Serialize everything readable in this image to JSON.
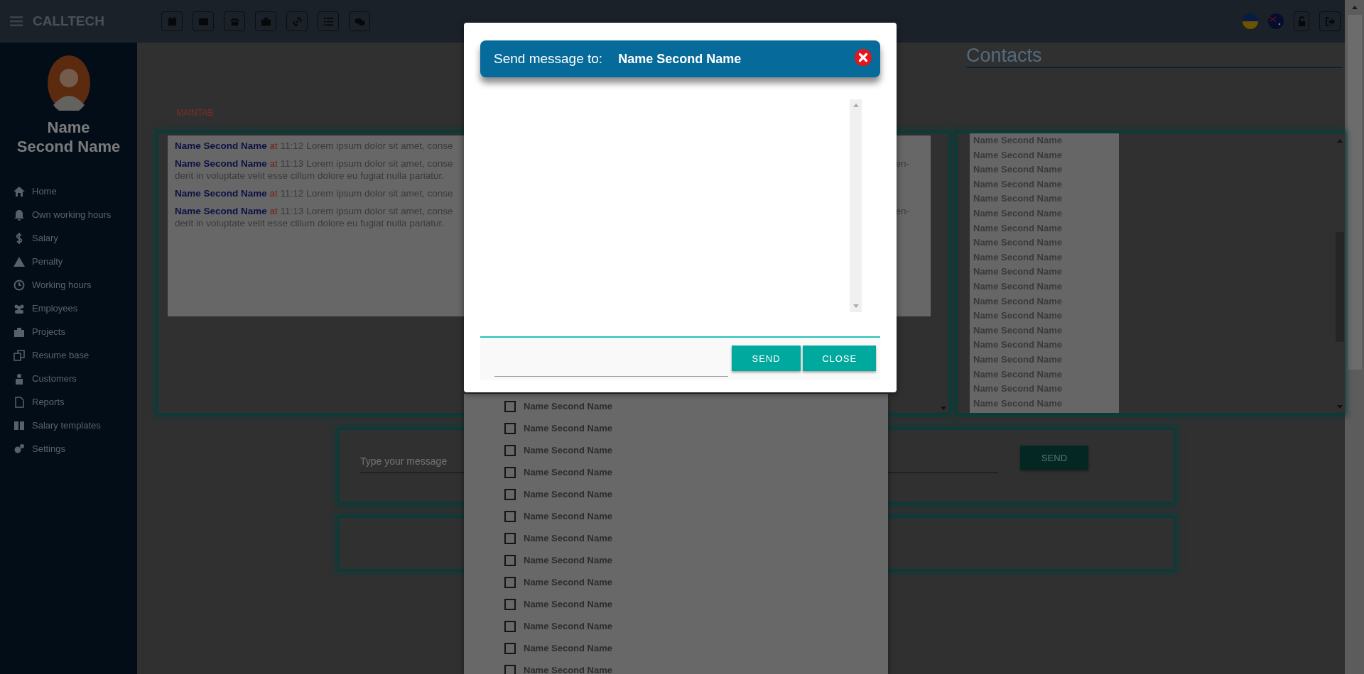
{
  "app": {
    "logo": "CALLTECH"
  },
  "user": {
    "first_name": "Name",
    "last_name": "Second Name"
  },
  "menu": [
    {
      "label": "Home"
    },
    {
      "label": "Own working hours"
    },
    {
      "label": "Salary"
    },
    {
      "label": "Penalty"
    },
    {
      "label": "Working hours"
    },
    {
      "label": "Employees"
    },
    {
      "label": "Projects"
    },
    {
      "label": "Resume base"
    },
    {
      "label": "Customers"
    },
    {
      "label": "Reports"
    },
    {
      "label": "Salary templates"
    },
    {
      "label": "Settings"
    }
  ],
  "tab_label": "MAINTAB",
  "messages": [
    {
      "author": "Name Second Name",
      "at": "at",
      "time": "11:12",
      "text": "Lorem ipsum dolor sit amet, conse"
    },
    {
      "author": "Name Second Name",
      "at": "at",
      "time": "11:13",
      "text": "Lorem ipsum dolor sit amet, conse",
      "tail": "en-",
      "continuation": "derit in voluptate velit esse cillum dolore eu fugiat nulla pariatur."
    },
    {
      "author": "Name Second Name",
      "at": "at",
      "time": "11:12",
      "text": "Lorem ipsum dolor sit amet, conse"
    },
    {
      "author": "Name Second Name",
      "at": "at",
      "time": "11:13",
      "text": "Lorem ipsum dolor sit amet, conse",
      "tail": "en-",
      "continuation": "derit in voluptate velit esse cillum dolore eu fugiat nulla pariatur."
    }
  ],
  "contacts": {
    "title": "Contacts",
    "names": [
      "Name Second Name",
      "Name Second Name",
      "Name Second Name",
      "Name Second Name",
      "Name Second Name",
      "Name Second Name",
      "Name Second Name",
      "Name Second Name",
      "Name Second Name",
      "Name Second Name",
      "Name Second Name",
      "Name Second Name",
      "Name Second Name",
      "Name Second Name",
      "Name Second Name",
      "Name Second Name",
      "Name Second Name",
      "Name Second Name",
      "Name Second Name"
    ]
  },
  "compose": {
    "placeholder": "Type your message",
    "send": "SEND"
  },
  "recipients": [
    {
      "name": "Name Second Name",
      "checked": false
    },
    {
      "name": "Name Second Name",
      "checked": false
    },
    {
      "name": "Name Second Name",
      "checked": false
    },
    {
      "name": "Name Second Name",
      "checked": false
    },
    {
      "name": "Name Second Name",
      "checked": false
    },
    {
      "name": "Name Second Name",
      "checked": false
    },
    {
      "name": "Name Second Name",
      "checked": false
    },
    {
      "name": "Name Second Name",
      "checked": false
    },
    {
      "name": "Name Second Name",
      "checked": false
    },
    {
      "name": "Name Second Name",
      "checked": false
    },
    {
      "name": "Name Second Name",
      "checked": false
    },
    {
      "name": "Name Second Name",
      "checked": false
    },
    {
      "name": "Name Second Name",
      "checked": false
    }
  ],
  "modal": {
    "title": "Send message to:",
    "recipient": "Name Second Name",
    "send": "SEND",
    "close": "CLOSE"
  }
}
